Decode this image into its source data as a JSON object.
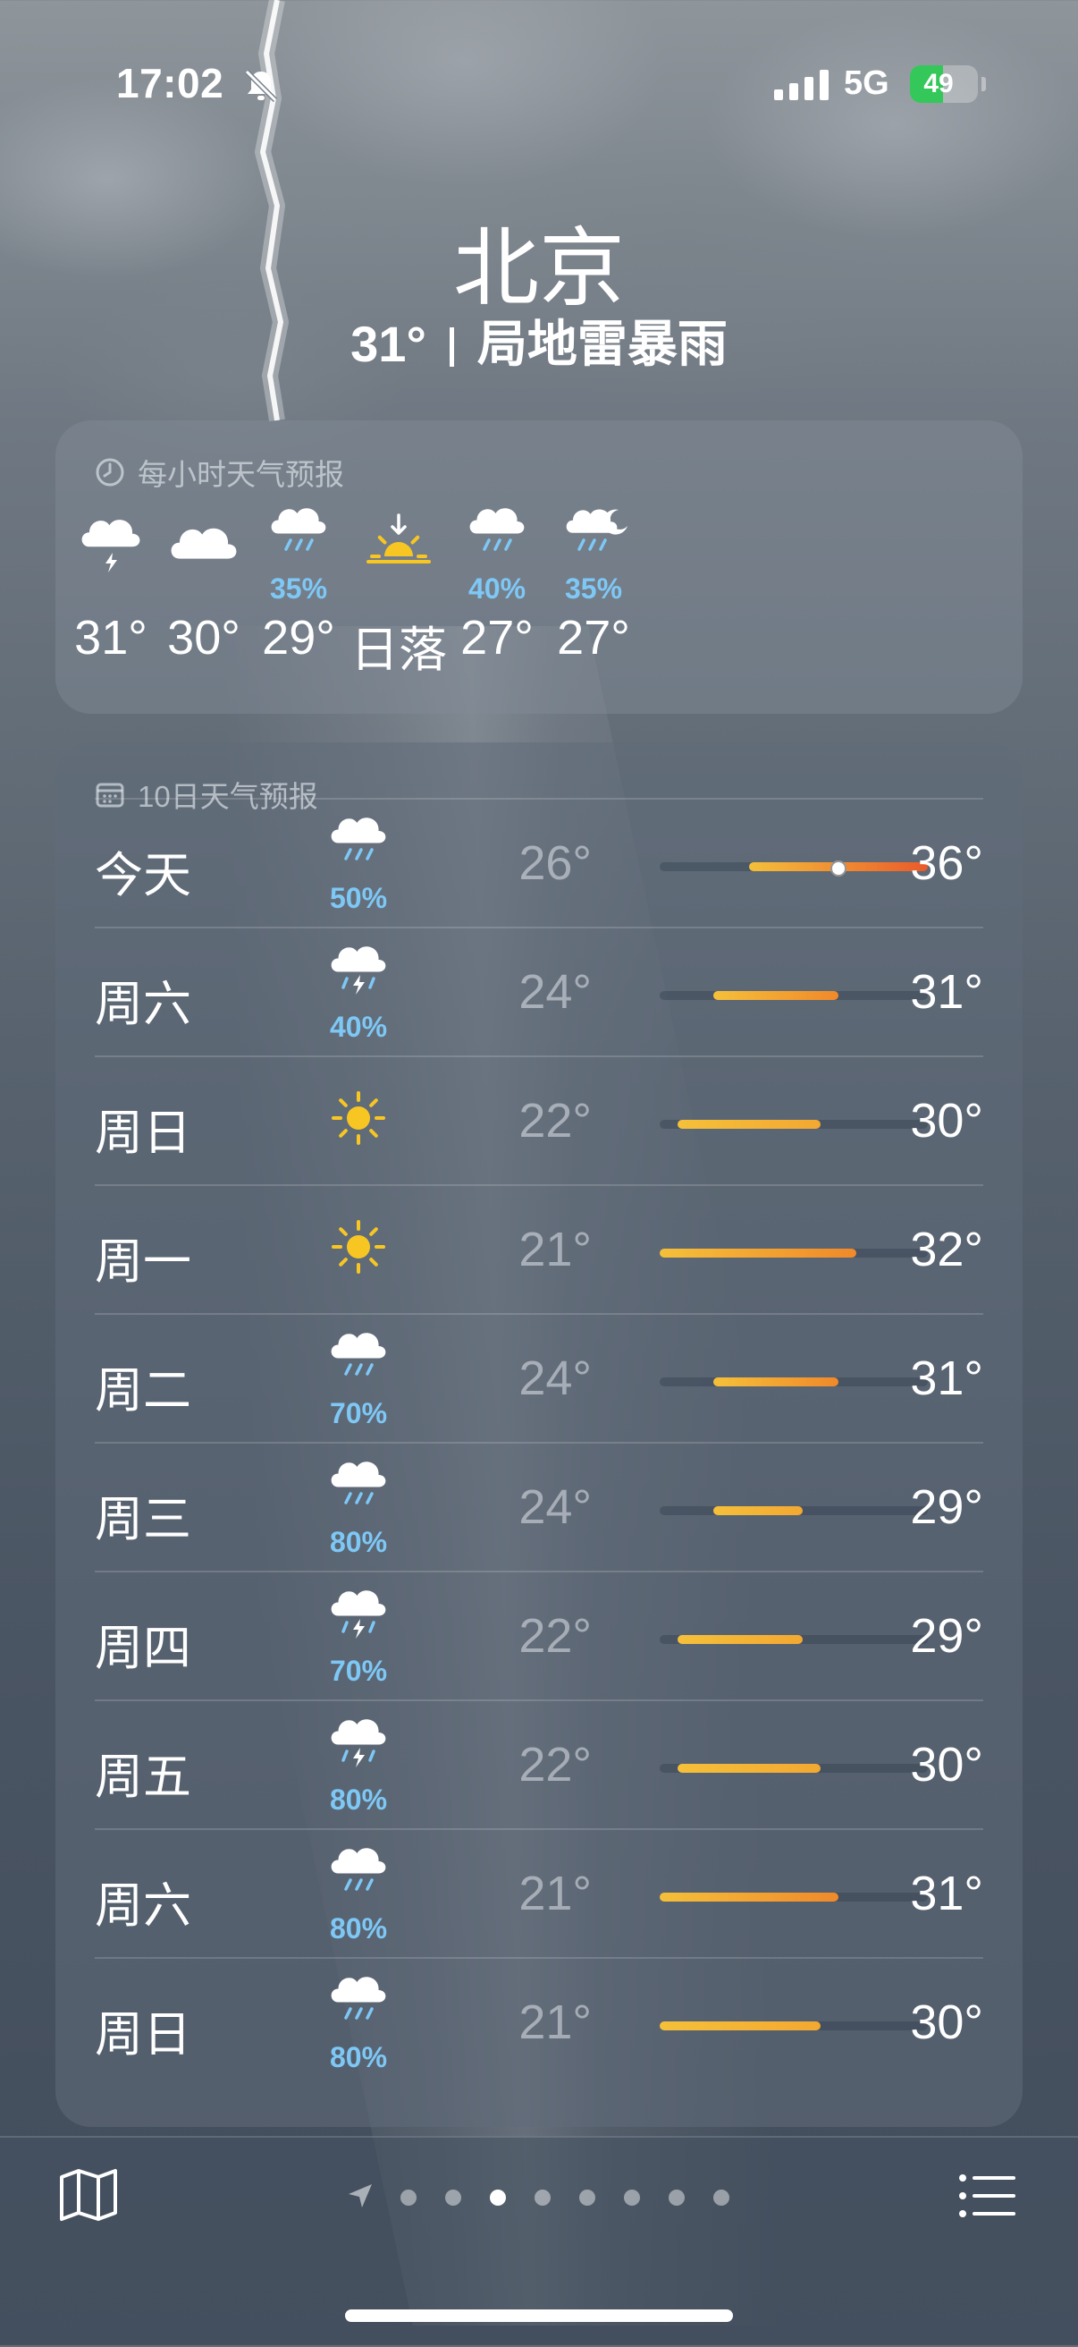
{
  "status_bar": {
    "time": "17:02",
    "network": "5G",
    "battery": "49",
    "battery_level": 0.49
  },
  "header": {
    "city": "北京",
    "temp": "31°",
    "condition": "局地雷暴雨"
  },
  "hourly": {
    "title": "每小时天气预报",
    "items": [
      {
        "icon": "cloud-bolt-icon",
        "pct": "",
        "temp": "31°"
      },
      {
        "icon": "cloud-icon",
        "pct": "",
        "temp": "30°"
      },
      {
        "icon": "cloud-rain-icon",
        "pct": "35%",
        "temp": "29°"
      },
      {
        "icon": "sunset-icon",
        "pct": "",
        "temp": "日落"
      },
      {
        "icon": "cloud-rain-icon",
        "pct": "40%",
        "temp": "27°"
      },
      {
        "icon": "cloud-moon-rain-icon",
        "pct": "35%",
        "temp": "27°"
      }
    ]
  },
  "daily": {
    "title": "10日天气预报",
    "range_min": 21,
    "range_max": 36,
    "rows": [
      {
        "day": "今天",
        "icon": "cloud-rain-icon",
        "pct": "50%",
        "lo": "26°",
        "hi": "36°",
        "lo_v": 26,
        "hi_v": 36,
        "current": 31
      },
      {
        "day": "周六",
        "icon": "cloud-bolt-rain-icon",
        "pct": "40%",
        "lo": "24°",
        "hi": "31°",
        "lo_v": 24,
        "hi_v": 31
      },
      {
        "day": "周日",
        "icon": "sun-icon",
        "pct": "",
        "lo": "22°",
        "hi": "30°",
        "lo_v": 22,
        "hi_v": 30
      },
      {
        "day": "周一",
        "icon": "sun-icon",
        "pct": "",
        "lo": "21°",
        "hi": "32°",
        "lo_v": 21,
        "hi_v": 32
      },
      {
        "day": "周二",
        "icon": "cloud-rain-icon",
        "pct": "70%",
        "lo": "24°",
        "hi": "31°",
        "lo_v": 24,
        "hi_v": 31
      },
      {
        "day": "周三",
        "icon": "cloud-rain-icon",
        "pct": "80%",
        "lo": "24°",
        "hi": "29°",
        "lo_v": 24,
        "hi_v": 29
      },
      {
        "day": "周四",
        "icon": "cloud-bolt-rain-icon",
        "pct": "70%",
        "lo": "22°",
        "hi": "29°",
        "lo_v": 22,
        "hi_v": 29
      },
      {
        "day": "周五",
        "icon": "cloud-bolt-rain-icon",
        "pct": "80%",
        "lo": "22°",
        "hi": "30°",
        "lo_v": 22,
        "hi_v": 30
      },
      {
        "day": "周六",
        "icon": "cloud-rain-icon",
        "pct": "80%",
        "lo": "21°",
        "hi": "31°",
        "lo_v": 21,
        "hi_v": 31
      },
      {
        "day": "周日",
        "icon": "cloud-rain-icon",
        "pct": "80%",
        "lo": "21°",
        "hi": "30°",
        "lo_v": 21,
        "hi_v": 30
      }
    ]
  },
  "bottom_bar": {
    "pages": 8,
    "active_page": 3
  },
  "colors": {
    "precip": "#7ec8f6",
    "battery": "#34c759",
    "sun": "#f8c623"
  }
}
